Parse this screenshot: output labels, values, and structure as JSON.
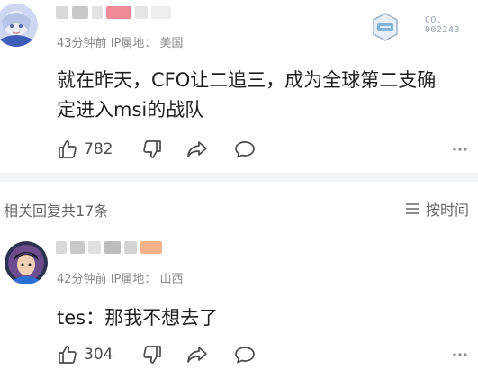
{
  "comments": [
    {
      "time": "43分钟前",
      "ip_label": "IP属地：",
      "location": "美国",
      "text_line1": "就在昨天，CFO让二追三，成为全球第二支确",
      "text_line2": "定进入msi的战队",
      "like_count": "782",
      "badge_code": "CO.\n002243"
    },
    {
      "time": "42分钟前",
      "ip_label": "IP属地：",
      "location": "山西",
      "text_line1": "tes：那我不想去了",
      "like_count": "304"
    }
  ],
  "replies_header": {
    "count_label": "相关回复共17条",
    "sort_label": "按时间"
  },
  "icons": {
    "like": "thumbs-up-icon",
    "dislike": "thumbs-down-icon",
    "share": "share-arrow-icon",
    "reply": "speech-bubble-icon",
    "sort": "hamburger-lines-icon"
  },
  "colors": {
    "accent_pink": "#f08a96",
    "accent_orange": "#f5b38a",
    "badge_blue": "#7fb3d9",
    "meta_gray": "#8a8a8a"
  }
}
